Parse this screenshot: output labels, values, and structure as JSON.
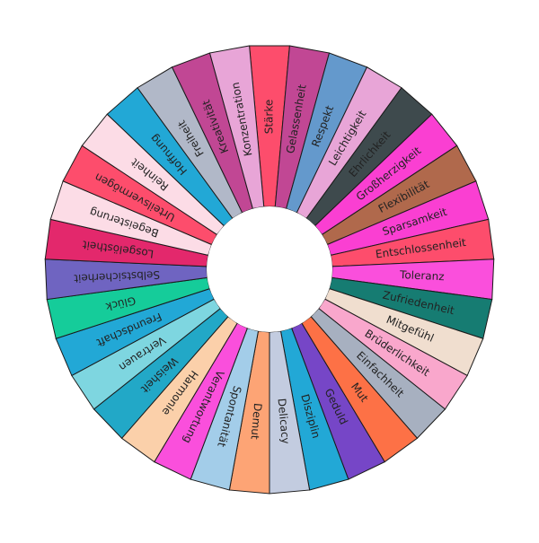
{
  "wheel": {
    "label_color": "#222222",
    "hub_color": "#ffffff",
    "segments": [
      {
        "label": "Stärke",
        "color": "#fd4d6c"
      },
      {
        "label": "Gelassenheit",
        "color": "#c14794"
      },
      {
        "label": "Respekt",
        "color": "#6499cc"
      },
      {
        "label": "Leichtigkeit",
        "color": "#e8a5d7"
      },
      {
        "label": "Ehrlichkeit",
        "color": "#3e4a4d"
      },
      {
        "label": "Großherzigkeit",
        "color": "#fa3fd2"
      },
      {
        "label": "Flexibilität",
        "color": "#b0694c"
      },
      {
        "label": "Sparsamkeit",
        "color": "#fa3fd2"
      },
      {
        "label": "Entschlossenheit",
        "color": "#fd4d6c"
      },
      {
        "label": "Toleranz",
        "color": "#fa4fdc"
      },
      {
        "label": "Zufriedenheit",
        "color": "#167c72"
      },
      {
        "label": "Mitgefühl",
        "color": "#f0decf"
      },
      {
        "label": "Brüderlichkeit",
        "color": "#f9a7cc"
      },
      {
        "label": "Einfachheit",
        "color": "#a7b0c0"
      },
      {
        "label": "Mut",
        "color": "#fd7146"
      },
      {
        "label": "Geduld",
        "color": "#7646c7"
      },
      {
        "label": "Disziplin",
        "color": "#22a8d6"
      },
      {
        "label": "Delicacy",
        "color": "#c3cce0"
      },
      {
        "label": "Demut",
        "color": "#fda475"
      },
      {
        "label": "Spontanität",
        "color": "#a3cde9"
      },
      {
        "label": "Verantwortung",
        "color": "#fa4fdc"
      },
      {
        "label": "Harmonie",
        "color": "#fbd0aa"
      },
      {
        "label": "Weisheit",
        "color": "#22a8c7"
      },
      {
        "label": "Vertrauen",
        "color": "#7ed6e0"
      },
      {
        "label": "Freundschaft",
        "color": "#22a8d6"
      },
      {
        "label": "Glück",
        "color": "#15cc9a"
      },
      {
        "label": "Selbstsicherheit",
        "color": "#6f64c1"
      },
      {
        "label": "Losgelöstheit",
        "color": "#e3286c"
      },
      {
        "label": "Begeisterung",
        "color": "#fcdce6"
      },
      {
        "label": "Urteilsvermögen",
        "color": "#fd4d6c"
      },
      {
        "label": "Reinheit",
        "color": "#fcdce6"
      },
      {
        "label": "Hoffnung",
        "color": "#22a8d6"
      },
      {
        "label": "Freiheit",
        "color": "#b1b8c8"
      },
      {
        "label": "Kreativität",
        "color": "#c14794"
      },
      {
        "label": "Konzentration",
        "color": "#e8a5d7"
      }
    ]
  }
}
